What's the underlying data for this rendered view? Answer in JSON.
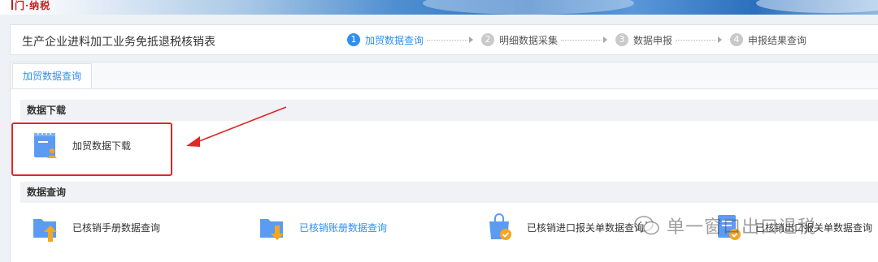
{
  "banner": {
    "logo_text": "门·纳税"
  },
  "header": {
    "title": "生产企业进料加工业务免抵退税核销表"
  },
  "steps": [
    {
      "num": "1",
      "label": "加贸数据查询",
      "active": true
    },
    {
      "num": "2",
      "label": "明细数据采集",
      "active": false
    },
    {
      "num": "3",
      "label": "数据申报",
      "active": false
    },
    {
      "num": "4",
      "label": "申报结果查询",
      "active": false
    }
  ],
  "tabs": [
    {
      "label": "加贸数据查询"
    }
  ],
  "download_section": {
    "title": "数据下载",
    "items": [
      {
        "label": "加贸数据下载",
        "icon": "document-download-icon"
      }
    ]
  },
  "query_section": {
    "title": "数据查询",
    "items": [
      {
        "label": "已核销手册数据查询",
        "icon": "folder-upload-icon"
      },
      {
        "label": "已核销账册数据查询",
        "icon": "folder-download-icon"
      },
      {
        "label": "已核销进口报关单数据查询",
        "icon": "bag-check-icon"
      },
      {
        "label": "已核销出口报关单数据查询",
        "icon": "document-check-icon"
      }
    ]
  },
  "watermark": {
    "text": "单一窗口出口退税"
  },
  "colors": {
    "accent": "#2e8ff0",
    "annotation": "#e0262a",
    "icon_blue": "#5b9cf2",
    "icon_orange": "#f5a623"
  }
}
